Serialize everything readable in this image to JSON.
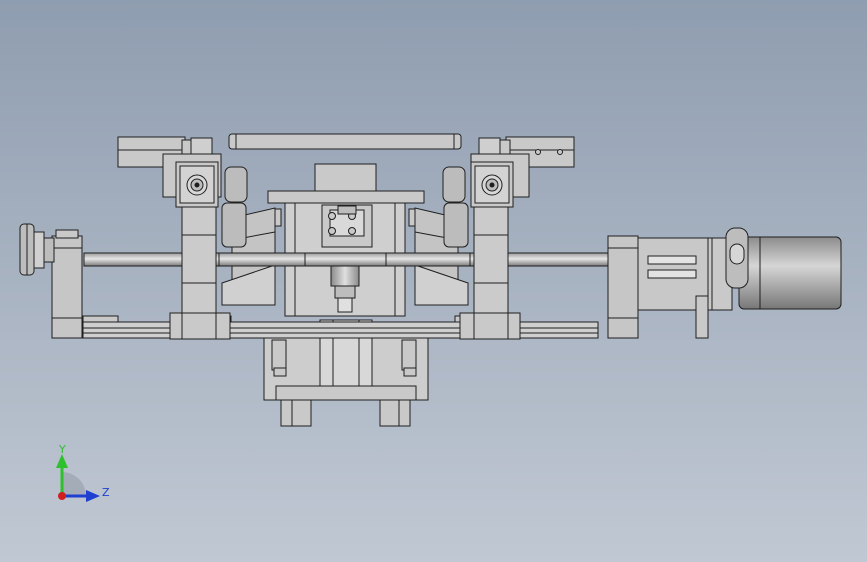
{
  "viewport": {
    "background_top": "#8f9db0",
    "background_bottom": "#c0c8d3",
    "part_color": "#c9c9c9",
    "edge_color": "#1f1f1f"
  },
  "triad": {
    "y_label": "Y",
    "z_label": "Z",
    "y_color": "#2fbf2f",
    "z_color": "#1f3fd0",
    "x_color": "#d01f1f"
  }
}
